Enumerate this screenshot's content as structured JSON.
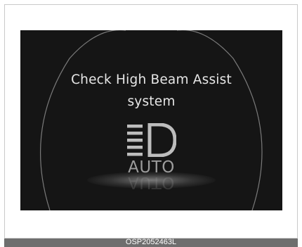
{
  "display": {
    "message_line1": "Check High Beam Assist",
    "message_line2": "system",
    "icon": "high-beam-assist-icon",
    "auto_label": "AUTO"
  },
  "caption": {
    "code": "OSP2052463L"
  },
  "colors": {
    "screen_background": "#151515",
    "text": "#e6e6e6",
    "icon": "#bdbdbd",
    "caption_bar": "#6e6e6e"
  }
}
